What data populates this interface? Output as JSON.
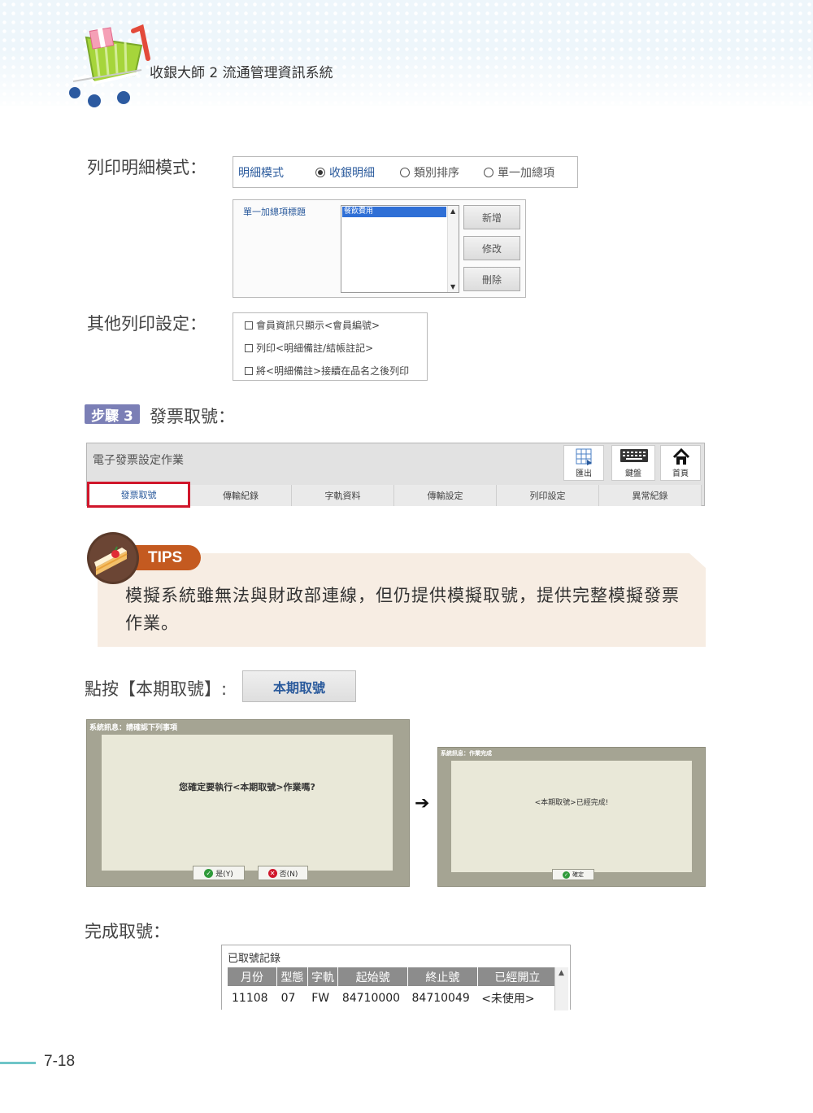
{
  "header": {
    "title": "收銀大師 2 流通管理資訊系統"
  },
  "print_mode": {
    "section_label": "列印明細模式：",
    "mode_label": "明細模式",
    "options": [
      "收銀明細",
      "類別排序",
      "單一加總項"
    ],
    "selected": "收銀明細"
  },
  "summary_title": {
    "label": "單一加總項標題",
    "list_selected": "餐飲費用",
    "buttons": [
      "新增",
      "修改",
      "刪除"
    ]
  },
  "other_settings": {
    "section_label": "其他列印設定：",
    "checkboxes": [
      "會員資訊只顯示<會員編號>",
      "列印<明細備註/結帳註記>",
      "將<明細備註>接續在品名之後列印"
    ]
  },
  "step3": {
    "badge": "步驟 3",
    "title": "發票取號："
  },
  "app": {
    "title": "電子發票設定作業",
    "tools": [
      "匯出",
      "鍵盤",
      "首頁"
    ],
    "tabs": [
      "發票取號",
      "傳輸紀錄",
      "字軌資料",
      "傳輸設定",
      "列印設定",
      "異常紀錄"
    ],
    "active_tab": "發票取號"
  },
  "tips": {
    "label": "TIPS",
    "text": "模擬系統雖無法與財政部連線，但仍提供模擬取號，提供完整模擬發票作業。"
  },
  "click": {
    "label": "點按【本期取號】:",
    "button": "本期取號"
  },
  "dialog_confirm": {
    "title": "系統訊息：請確認下列事項",
    "message": "您確定要執行<本期取號>作業嗎?",
    "yes": "是(Y)",
    "no": "否(N)"
  },
  "dialog_done": {
    "title": "系統訊息：作業完成",
    "message": "<本期取號>已經完成!",
    "ok": "確定"
  },
  "done": {
    "label": "完成取號："
  },
  "records": {
    "title": "已取號記錄",
    "columns": [
      "月份",
      "型態",
      "字軌",
      "起始號",
      "終止號",
      "已經開立"
    ],
    "rows": [
      [
        "11108",
        "07",
        "FW",
        "84710000",
        "84710049",
        "<未使用>"
      ]
    ]
  },
  "page_number": "7-18",
  "colors": {
    "accent_red": "#d0162b",
    "step_badge": "#7b7fb6",
    "tips_orange": "#c45a20",
    "link_blue": "#2a5a9c"
  }
}
